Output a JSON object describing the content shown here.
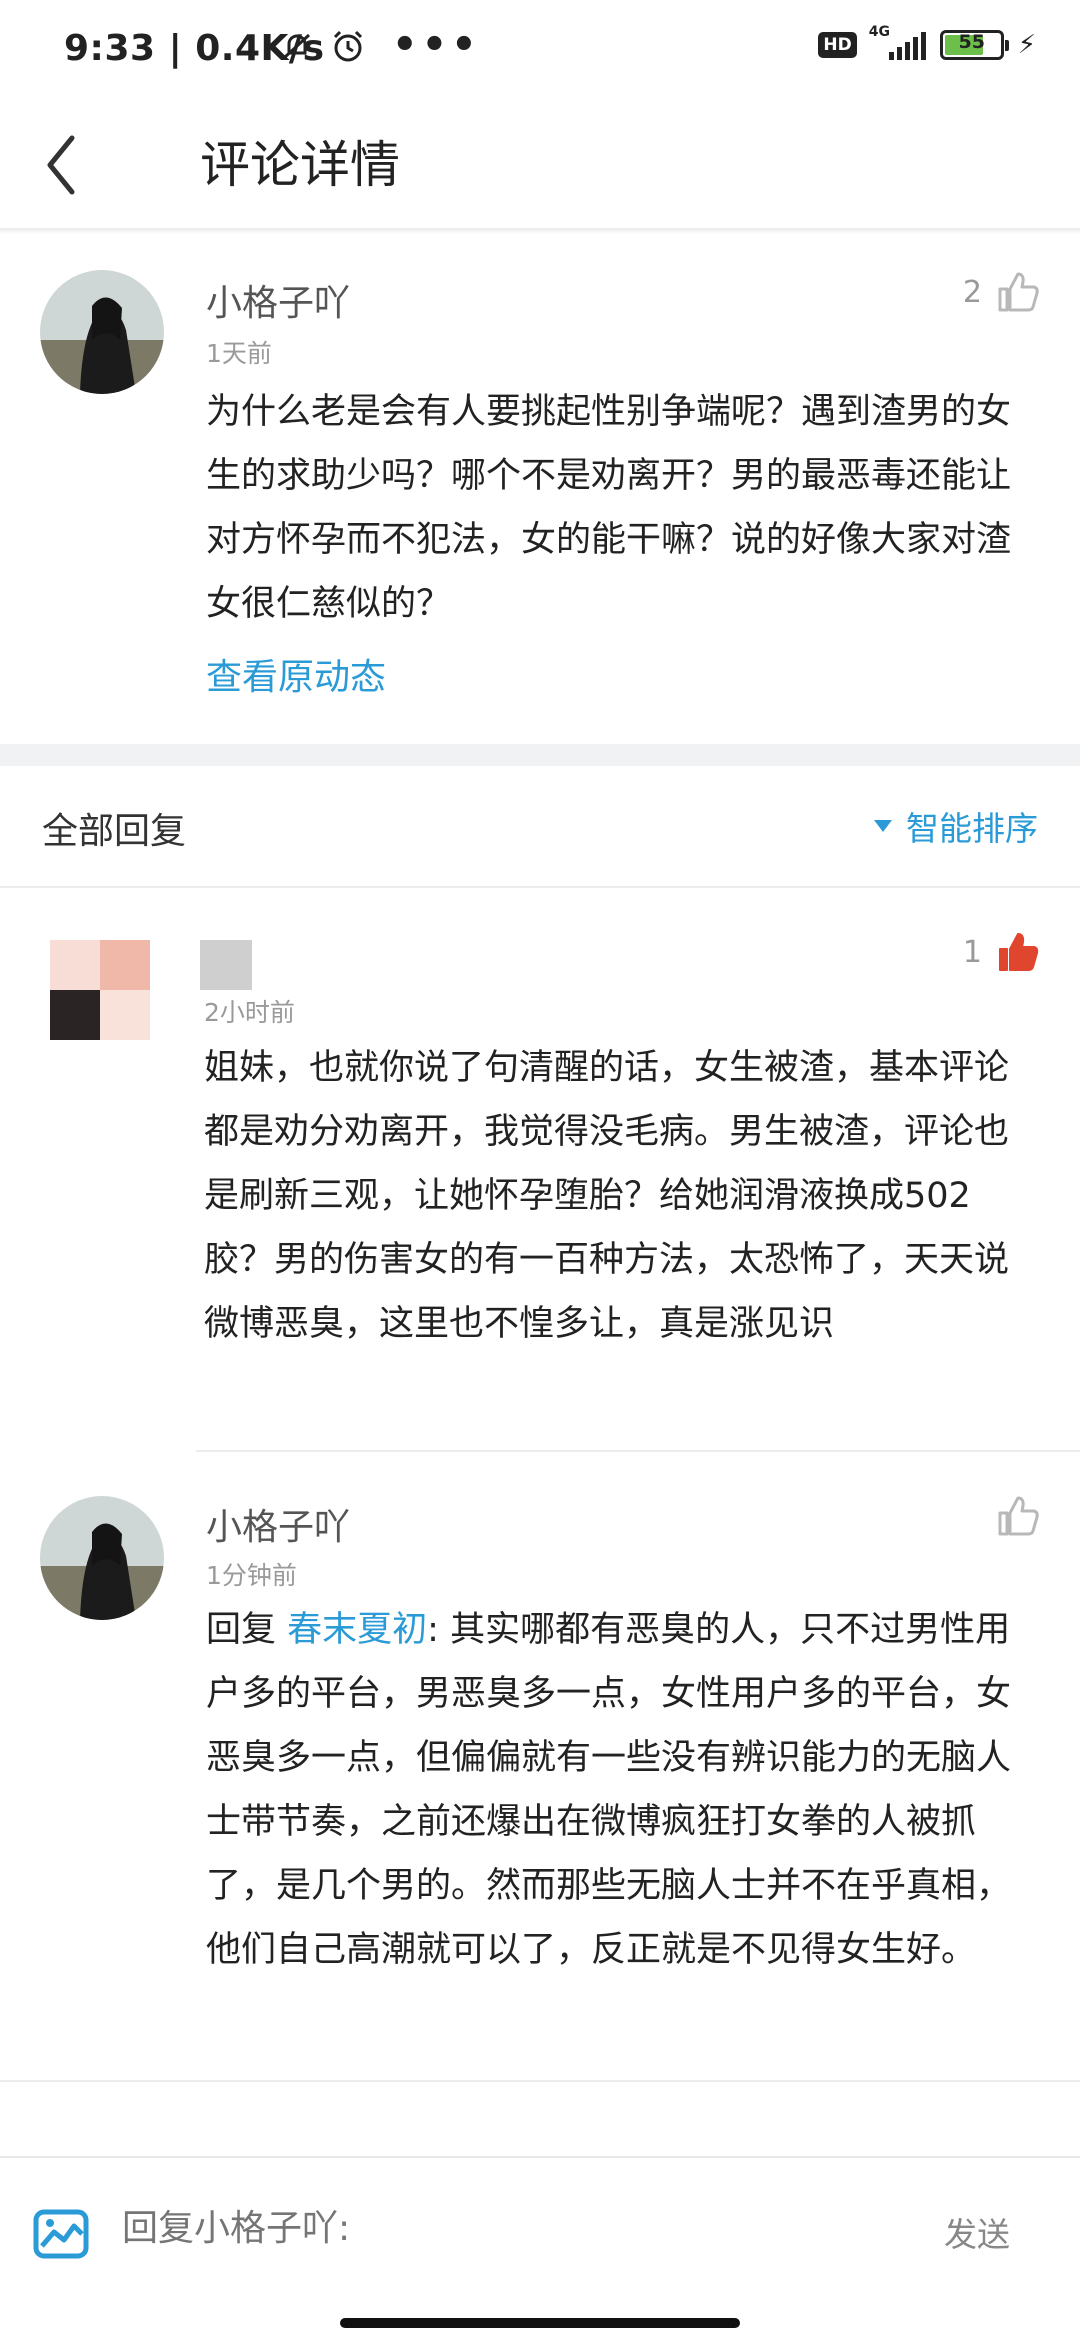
{
  "status_bar": {
    "time_speed": "9:33 | 0.4K/s",
    "hd_badge": "HD",
    "network": "4G",
    "battery": "55"
  },
  "header": {
    "title": "评论详情"
  },
  "main_comment": {
    "user": "小格子吖",
    "time": "1天前",
    "likes": "2",
    "text": "为什么老是会有人要挑起性别争端呢？遇到渣男的女生的求助少吗？哪个不是劝离开？男的最恶毒还能让对方怀孕而不犯法，女的能干嘛？说的好像大家对渣女很仁慈似的？",
    "view_original": "查看原动态"
  },
  "replies_section": {
    "title": "全部回复",
    "sort_label": "智能排序"
  },
  "replies": [
    {
      "time": "2小时前",
      "likes": "1",
      "liked": true,
      "text": "姐妹，也就你说了句清醒的话，女生被渣，基本评论都是劝分劝离开，我觉得没毛病。男生被渣，评论也是刷新三观，让她怀孕堕胎？给她润滑液换成502胶？男的伤害女的有一百种方法，太恐怖了，天天说微博恶臭，这里也不惶多让，真是涨见识"
    },
    {
      "user": "小格子吖",
      "time": "1分钟前",
      "reply_prefix": "回复 ",
      "reply_to": "春末夏初",
      "text": ": 其实哪都有恶臭的人，只不过男性用户多的平台，男恶臭多一点，女性用户多的平台，女恶臭多一点，但偏偏就有一些没有辨识能力的无脑人士带节奏，之前还爆出在微博疯狂打女拳的人被抓了，是几个男的。然而那些无脑人士并不在乎真相，他们自己高潮就可以了，反正就是不见得女生好。"
    }
  ],
  "bottom_bar": {
    "placeholder": "回复小格子吖:",
    "send_label": "发送"
  },
  "colors": {
    "link": "#2a9bd6",
    "like_active": "#e0452e"
  }
}
